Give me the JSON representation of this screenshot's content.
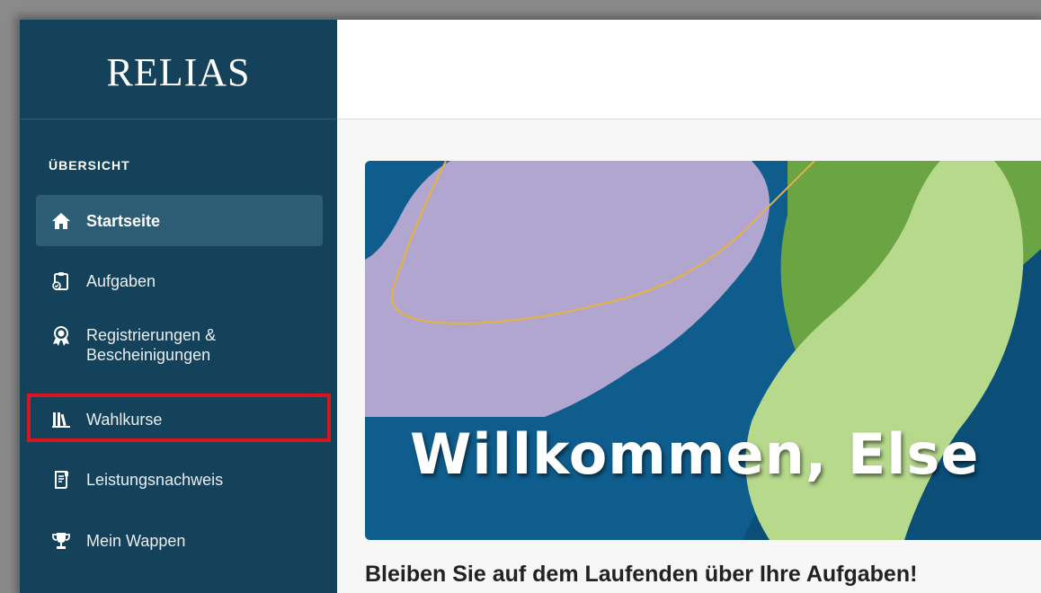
{
  "brand": {
    "logo_text": "RELIAS"
  },
  "sidebar": {
    "section_label": "ÜBERSICHT",
    "items": [
      {
        "label": "Startseite",
        "icon": "home-icon",
        "active": true
      },
      {
        "label": "Aufgaben",
        "icon": "clipboard-check-icon",
        "active": false
      },
      {
        "label": "Registrierungen & Bescheinigungen",
        "icon": "award-badge-icon",
        "active": false
      },
      {
        "label": "Wahlkurse",
        "icon": "books-icon",
        "active": false,
        "highlighted": true
      },
      {
        "label": "Leistungsnachweis",
        "icon": "transcript-icon",
        "active": false
      },
      {
        "label": "Mein Wappen",
        "icon": "trophy-icon",
        "active": false
      }
    ]
  },
  "main": {
    "banner": {
      "welcome_text": "Willkommen, Else"
    },
    "subheading": "Bleiben Sie auf dem Laufenden über Ihre Aufgaben!"
  },
  "colors": {
    "sidebar_bg": "#13425a",
    "active_item_bg": "#2c5d75",
    "highlight_border": "#d9161f",
    "banner_blue": "#0e5d8d",
    "banner_lavender": "#b1a6d0",
    "banner_green": "#6aa443",
    "banner_light_green": "#b6d98c",
    "banner_line": "#e8b23a"
  }
}
